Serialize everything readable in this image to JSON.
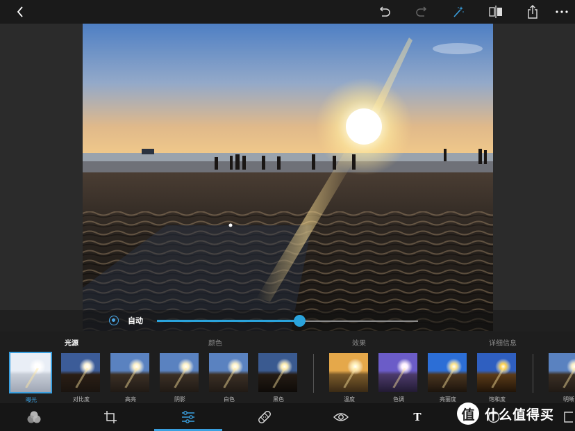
{
  "topbar": {
    "icons": [
      "back-icon",
      "undo-icon",
      "redo-icon",
      "magic-wand-icon",
      "compare-icon",
      "share-icon",
      "more-icon"
    ]
  },
  "slider": {
    "auto_label": "自动",
    "value_fraction": 0.545,
    "accent": "#2aa3dc"
  },
  "categories": [
    {
      "label": "光源",
      "active": true
    },
    {
      "label": "颜色",
      "active": false
    },
    {
      "label": "效果",
      "active": false
    },
    {
      "label": "详细信息",
      "active": false
    }
  ],
  "thumbnails": [
    {
      "label": "曝光",
      "selected": true,
      "tint": "exposure"
    },
    {
      "label": "对比度",
      "selected": false,
      "tint": "contrast"
    },
    {
      "label": "高亮",
      "selected": false,
      "tint": "normal"
    },
    {
      "label": "阴影",
      "selected": false,
      "tint": "normal"
    },
    {
      "label": "白色",
      "selected": false,
      "tint": "normal"
    },
    {
      "label": "黑色",
      "selected": false,
      "tint": "dark"
    },
    {
      "label": "温度",
      "selected": false,
      "tint": "warm"
    },
    {
      "label": "色调",
      "selected": false,
      "tint": "purple"
    },
    {
      "label": "亮丽度",
      "selected": false,
      "tint": "vivid"
    },
    {
      "label": "饱和度",
      "selected": false,
      "tint": "saturated"
    },
    {
      "label": "明晰",
      "selected": false,
      "tint": "normal"
    }
  ],
  "bottombar": {
    "tools": [
      "filters-icon",
      "crop-icon",
      "adjust-icon",
      "heal-icon",
      "red-eye-icon",
      "text-tool",
      "sticker-icon",
      "border-icon"
    ],
    "text_tool_label": "T",
    "active_tool": "adjust-icon"
  },
  "watermark": {
    "mark": "值",
    "text": "什么值得买"
  }
}
